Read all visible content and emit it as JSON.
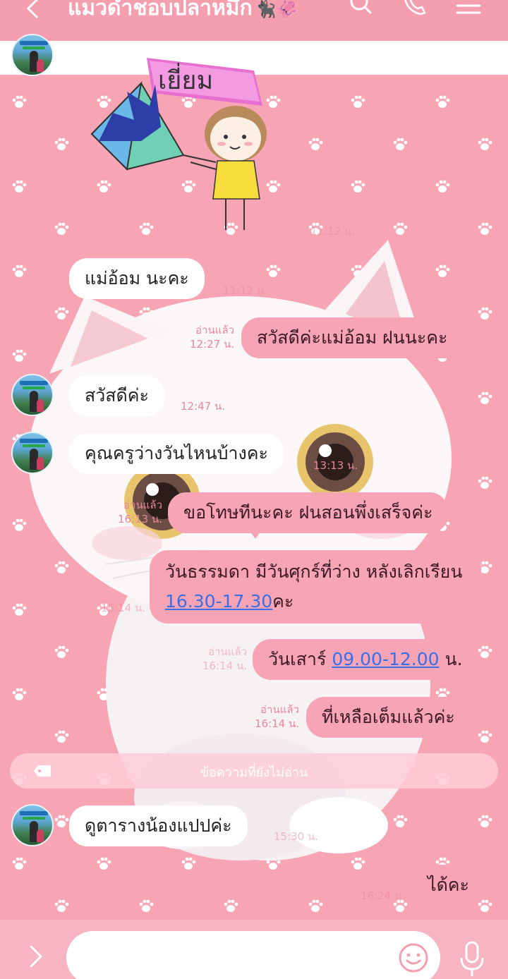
{
  "header": {
    "title": "แมวดำชอบปลาหมึก",
    "emoji": "🐈‍⬛🦑"
  },
  "sticker": {
    "text": "เยี่ยม"
  },
  "messages": [
    {
      "id": "m1",
      "direction": "in",
      "text": "แม่อ้อม นะคะ",
      "time": "11:12 น."
    },
    {
      "id": "m2",
      "direction": "out",
      "text": "สวัสดีค่ะแม่อ้อม ฝนนะคะ",
      "read": "อ่านแล้ว",
      "time": "12:27 น."
    },
    {
      "id": "m3",
      "direction": "in",
      "text": "สวัสดีค่ะ",
      "time": "12:47 น."
    },
    {
      "id": "m4",
      "direction": "in",
      "text": "คุณครูว่างวันไหนบ้างคะ",
      "time": "13:13 น."
    },
    {
      "id": "m5",
      "direction": "out",
      "text": "ขอโทษทีนะคะ ฝนสอนพึ่งเสร็จค่ะ",
      "read": "อ่านแล้ว",
      "time": "16:13 น."
    },
    {
      "id": "m6",
      "direction": "out",
      "text_before": "วันธรรมดา มีวันศุกร์ที่ว่าง หลังเลิกเรียน ",
      "link": "16.30-17.30",
      "text_after": "คะ",
      "time": "16:14 น."
    },
    {
      "id": "m7",
      "direction": "out",
      "text_before": "วันเสาร์ ",
      "link": "09.00-12.00",
      "text_after": " น.",
      "read": "อ่านแล้ว",
      "time": "16:14 น."
    },
    {
      "id": "m8",
      "direction": "out",
      "text": "ที่เหลือเต็มแล้วค่ะ",
      "read": "อ่านแล้ว",
      "time": "16:14 น."
    },
    {
      "id": "m9",
      "direction": "in",
      "text": "ดูตารางน้องแปปค่ะ",
      "time": "15:30 น."
    },
    {
      "id": "m10",
      "direction": "out",
      "text": "ได้คะ",
      "time": "16:24 น."
    }
  ],
  "unread_divider": {
    "text": "ข้อความที่ยังไม่อ่าน"
  },
  "input": {
    "value": "",
    "placeholder": ""
  },
  "colors": {
    "background": "#f7a5b5",
    "header": "#f49fb0",
    "incoming_bubble": "#ffffff",
    "outgoing_bubble": "#f7a4b6",
    "meta_text": "#e9879b",
    "link": "#3b6fe6"
  },
  "icons": [
    "back-icon",
    "search-icon",
    "phone-icon",
    "menu-icon",
    "paw-icon",
    "expand-icon",
    "emoji-icon",
    "mic-icon",
    "tag-icon"
  ]
}
